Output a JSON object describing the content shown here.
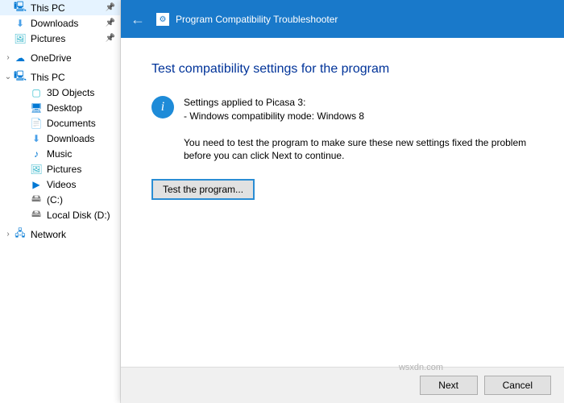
{
  "sidebar": {
    "items": [
      {
        "label": "This PC",
        "icon": "🖳",
        "pin": true,
        "chev": ""
      },
      {
        "label": "Downloads",
        "icon": "⬇",
        "pin": true,
        "chev": ""
      },
      {
        "label": "Pictures",
        "icon": "🖼",
        "pin": true,
        "chev": ""
      },
      {
        "label": "OneDrive",
        "icon": "☁",
        "pin": false,
        "chev": "›"
      },
      {
        "label": "This PC",
        "icon": "🖳",
        "pin": false,
        "chev": "⌄"
      },
      {
        "label": "3D Objects",
        "icon": "▢",
        "pin": false,
        "chev": ""
      },
      {
        "label": "Desktop",
        "icon": "🖥",
        "pin": false,
        "chev": ""
      },
      {
        "label": "Documents",
        "icon": "📄",
        "pin": false,
        "chev": ""
      },
      {
        "label": "Downloads",
        "icon": "⬇",
        "pin": false,
        "chev": ""
      },
      {
        "label": "Music",
        "icon": "♪",
        "pin": false,
        "chev": ""
      },
      {
        "label": "Pictures",
        "icon": "🖼",
        "pin": false,
        "chev": ""
      },
      {
        "label": "Videos",
        "icon": "▶",
        "pin": false,
        "chev": ""
      },
      {
        "label": "(C:)",
        "icon": "🖴",
        "pin": false,
        "chev": ""
      },
      {
        "label": "Local Disk (D:)",
        "icon": "🖴",
        "pin": false,
        "chev": ""
      },
      {
        "label": "Network",
        "icon": "🖧",
        "pin": false,
        "chev": "›"
      }
    ]
  },
  "dialog": {
    "title": "Program Compatibility Troubleshooter",
    "heading": "Test compatibility settings for the program",
    "info_line1": "Settings applied to Picasa 3:",
    "info_line2": "- Windows compatibility mode: Windows 8",
    "instruction": "You need to test the program to make sure these new settings fixed the problem before you can click Next to continue.",
    "test_button": "Test the program...",
    "next": "Next",
    "cancel": "Cancel"
  },
  "watermark": "wsxdn.com"
}
